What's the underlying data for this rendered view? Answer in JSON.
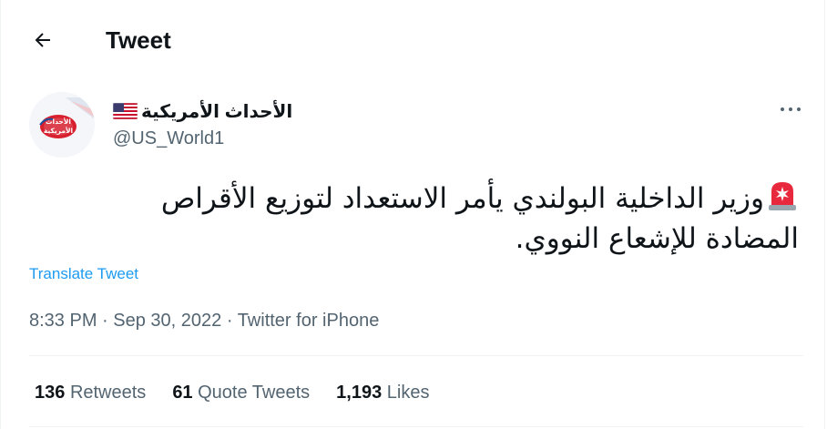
{
  "header": {
    "title": "Tweet"
  },
  "author": {
    "display_name": "الأحداث الأمريكية",
    "handle": "@US_World1",
    "avatar_text_top": "الأحداث",
    "avatar_text_bottom": "الأمريكية"
  },
  "tweet": {
    "text": "وزير الداخلية البولندي يأمر الاستعداد لتوزيع الأقراص المضادة للإشعاع النووي.",
    "translate_label": "Translate Tweet",
    "time": "8:33 PM",
    "date": "Sep 30, 2022",
    "source": "Twitter for iPhone",
    "separator": " · "
  },
  "stats": [
    {
      "count": "136",
      "label": "Retweets"
    },
    {
      "count": "61",
      "label": "Quote Tweets"
    },
    {
      "count": "1,193",
      "label": "Likes"
    }
  ],
  "icons": {
    "back": "arrow-left-icon",
    "more": "more-horizontal-icon",
    "flag": "us-flag-icon",
    "siren": "rotating-light-icon"
  },
  "colors": {
    "accent": "#1d9bf0",
    "text": "#0f1419",
    "secondary_text": "#536471",
    "divider": "#eff3f4",
    "siren_red": "#e8283c"
  }
}
